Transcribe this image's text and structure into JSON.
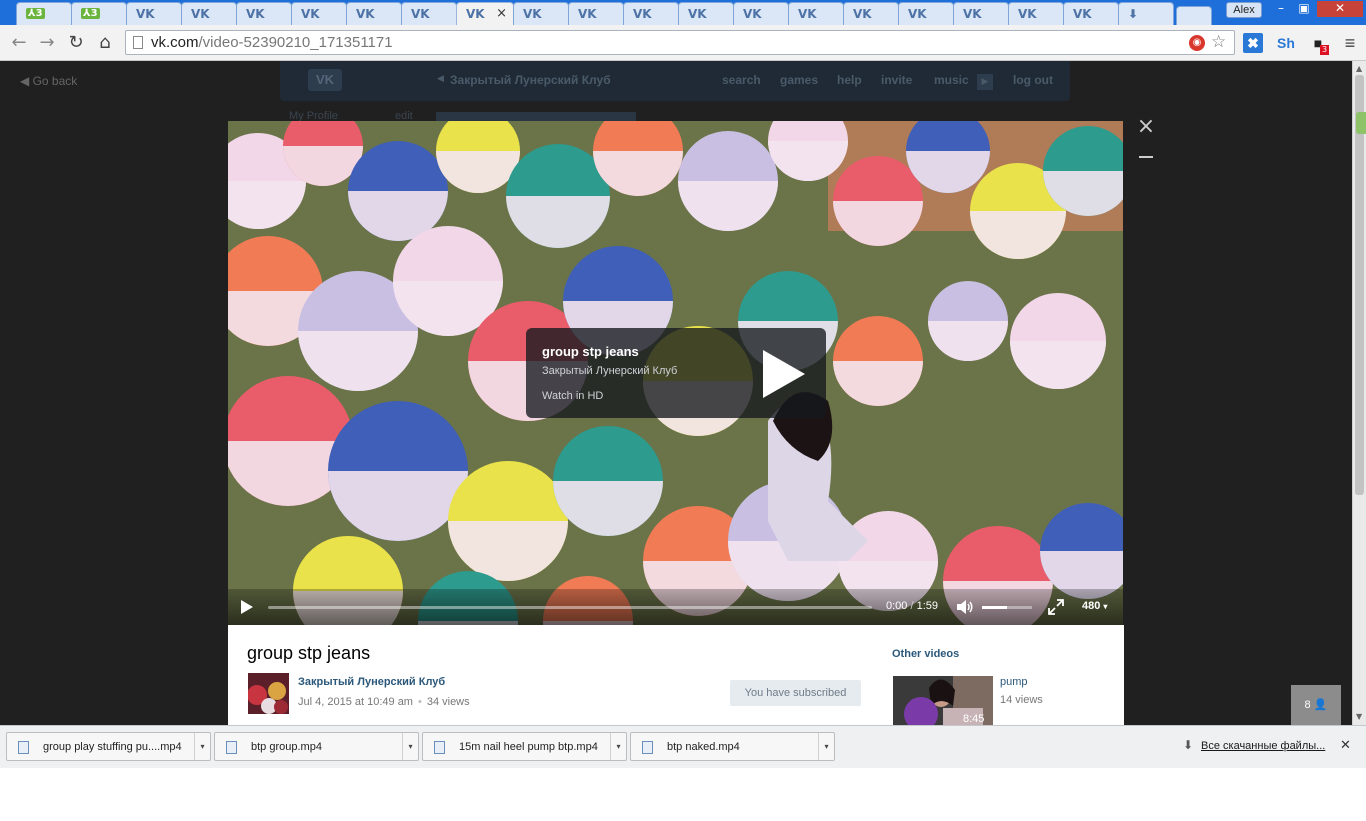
{
  "browser": {
    "tabs": [
      {
        "favicon": "⅄3",
        "text": "",
        "style": "g"
      },
      {
        "favicon": "⅄3",
        "text": "",
        "style": "g"
      },
      {
        "favicon": "VK",
        "text": "",
        "style": "vk"
      },
      {
        "favicon": "VK",
        "text": "",
        "style": "vk"
      },
      {
        "favicon": "VK",
        "text": "",
        "style": "vk"
      },
      {
        "favicon": "VK",
        "text": "",
        "style": "vk"
      },
      {
        "favicon": "VK",
        "text": "",
        "style": "vk"
      },
      {
        "favicon": "VK",
        "text": "",
        "style": "vk"
      },
      {
        "favicon": "VK",
        "text": "",
        "style": "vk",
        "active": true,
        "close": "×"
      },
      {
        "favicon": "VK",
        "text": "",
        "style": "vk"
      },
      {
        "favicon": "VK",
        "text": "",
        "style": "vk"
      },
      {
        "favicon": "VK",
        "text": "",
        "style": "vk"
      },
      {
        "favicon": "VK",
        "text": "",
        "style": "vk"
      },
      {
        "favicon": "VK",
        "text": "",
        "style": "vk"
      },
      {
        "favicon": "VK",
        "text": "",
        "style": "vk"
      },
      {
        "favicon": "VK",
        "text": "",
        "style": "vk"
      },
      {
        "favicon": "VK",
        "text": "",
        "style": "vk"
      },
      {
        "favicon": "VK",
        "text": "",
        "style": "vk"
      },
      {
        "favicon": "VK",
        "text": "",
        "style": "vk"
      },
      {
        "favicon": "VK",
        "text": "",
        "style": "vk"
      },
      {
        "favicon": "⬇",
        "text": "",
        "style": "dl"
      }
    ],
    "user_name": "Alex",
    "window_buttons": {
      "minimize": "–",
      "maximize": "▣",
      "close": "✕"
    },
    "nav": {
      "back": "←",
      "forward": "→",
      "reload": "↻",
      "home": "⌂"
    },
    "url_host": "vk.com",
    "url_path": "/video-52390210_171351171",
    "extensions": {
      "star": "☆",
      "ext1": "◉",
      "ext2": "✖",
      "ext3": "Sh",
      "ext4": "■",
      "ext4_badge": "3",
      "menu": "≡"
    }
  },
  "vk_page": {
    "go_back": "Go back",
    "logo": "VK",
    "community": "Закрытый Лунерский Клуб",
    "nav": [
      "search",
      "games",
      "help",
      "invite",
      "music",
      "log out"
    ],
    "sidebar_profile": "My Profile",
    "sidebar_edit": "edit"
  },
  "player": {
    "close_icon": "×",
    "card": {
      "title": "group stp jeans",
      "author": "Закрытый Лунерский Клуб",
      "hd_link": "Watch in HD"
    },
    "current_time": "0:00",
    "duration": "1:59",
    "time_separator": "/",
    "progress": 0.0,
    "volume": 0.5,
    "quality": "480"
  },
  "video_info": {
    "title": "group stp jeans",
    "author": "Закрытый Лунерский Клуб",
    "date": "Jul 4, 2015 at 10:49 am",
    "dot": "•",
    "views": "34 views",
    "subscribe_label": "You have subscribed",
    "other_videos_title": "Other videos",
    "other_videos": [
      {
        "title": "pump",
        "views": "14 views",
        "duration": "8:45"
      }
    ],
    "viewer_count": "8"
  },
  "downloads": {
    "items": [
      {
        "name": "group play stuffing pu....mp4"
      },
      {
        "name": "btp group.mp4"
      },
      {
        "name": "15m nail heel pump btp.mp4"
      },
      {
        "name": "btp naked.mp4"
      }
    ],
    "drop_icon": "▾",
    "all_label": "Все скачанные файлы...",
    "all_icon": "⬇",
    "close_icon": "✕"
  },
  "colors": {
    "tabstrip": "#1e6fd9",
    "vk_link": "#2b587a",
    "page_dim": "#202020"
  }
}
